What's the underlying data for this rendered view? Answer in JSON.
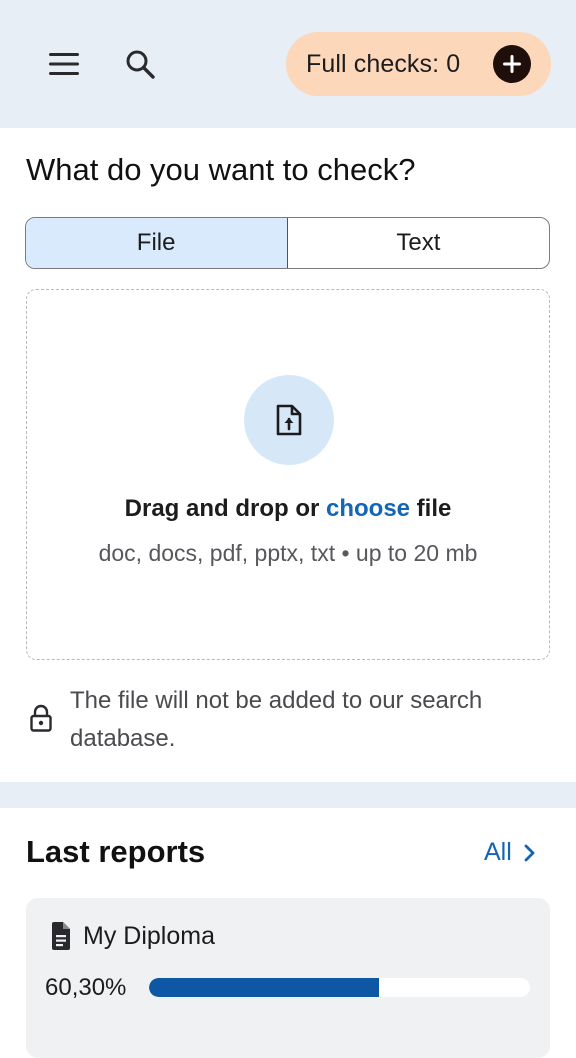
{
  "header": {
    "full_checks_label": "Full checks: 0"
  },
  "main": {
    "heading": "What do you want to check?",
    "tabs": [
      {
        "label": "File",
        "active": true
      },
      {
        "label": "Text",
        "active": false
      }
    ],
    "dropzone": {
      "prefix": "Drag and drop or ",
      "link": "choose",
      "suffix": " file",
      "formats": "doc, docs, pdf, pptx, txt • up to 20 mb"
    },
    "privacy_note": "The file will not be added to our search database."
  },
  "reports": {
    "title": "Last reports",
    "all_label": "All",
    "items": [
      {
        "name": "My Diploma",
        "percent_label": "60,30%",
        "percent": 0.603
      }
    ]
  },
  "colors": {
    "accent": "#1565b5",
    "progress": "#0d57a5",
    "pill": "#fcd7b9",
    "header_bg": "#e7eef6"
  },
  "icons": [
    "menu-icon",
    "search-icon",
    "plus-icon",
    "file-upload-icon",
    "lock-icon",
    "chevron-right-icon",
    "document-icon"
  ]
}
